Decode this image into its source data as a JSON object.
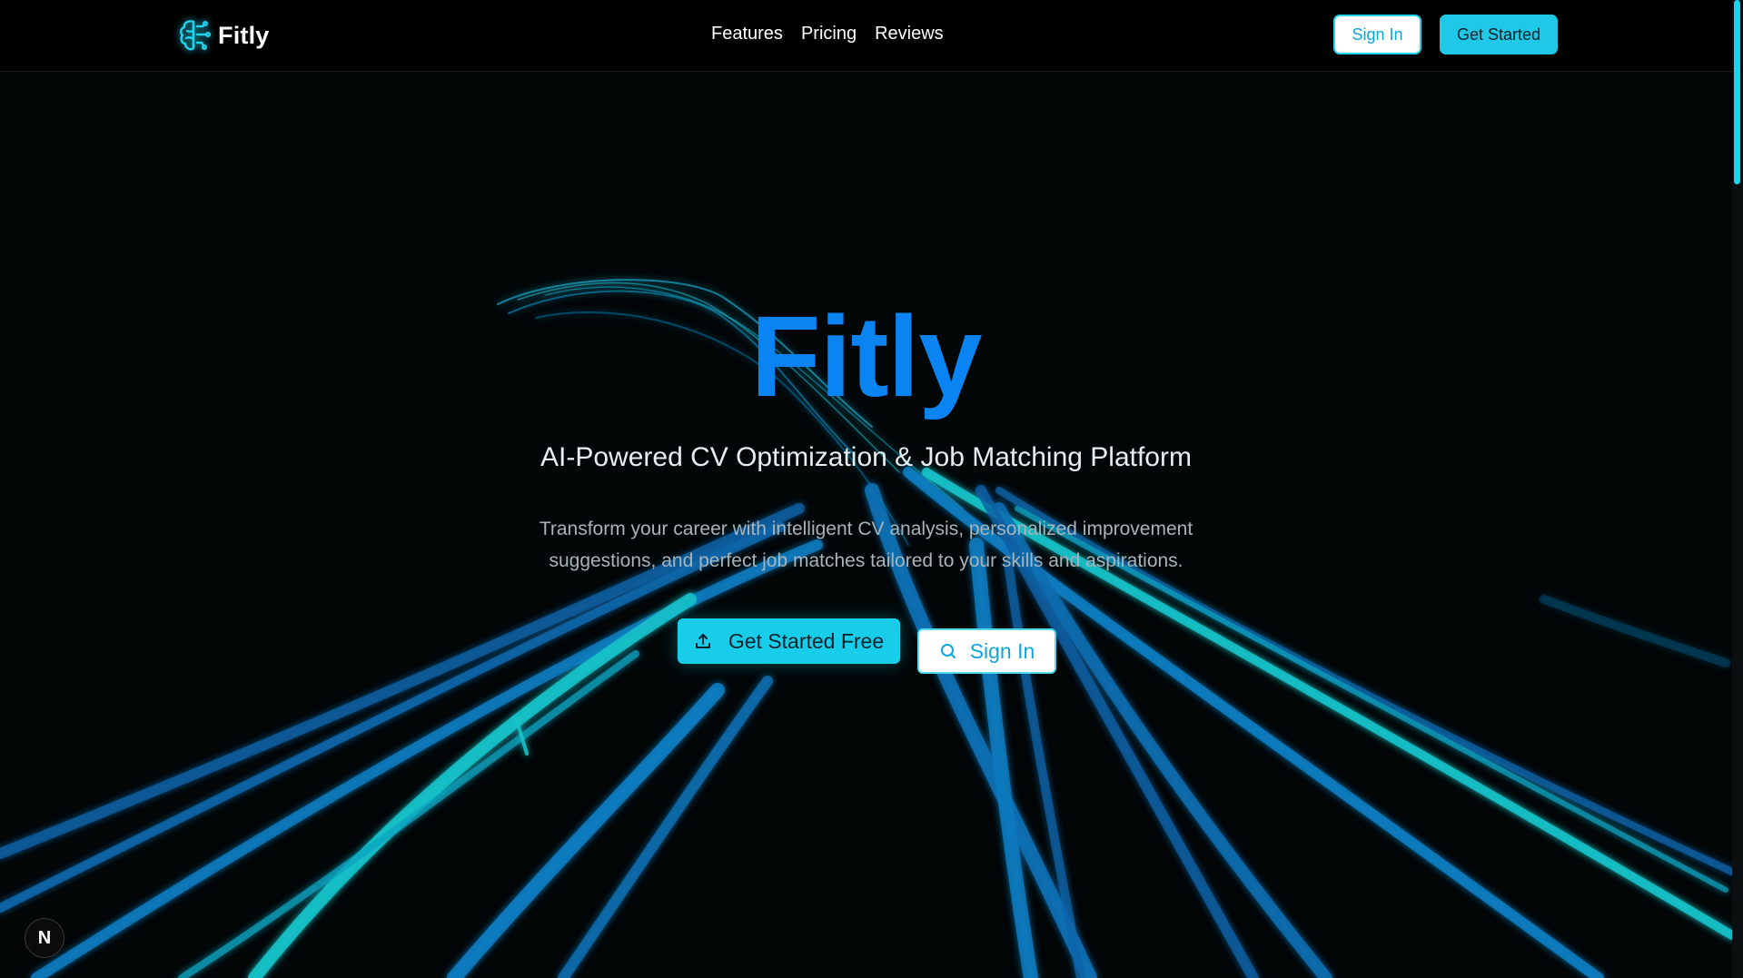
{
  "header": {
    "brand": "Fitly",
    "nav": [
      "Features",
      "Pricing",
      "Reviews"
    ],
    "sign_in": "Sign In",
    "get_started": "Get Started"
  },
  "hero": {
    "title": "Fitly",
    "subtitle": "AI-Powered CV Optimization & Job Matching Platform",
    "description": "Transform your career with intelligent CV analysis, personalized improvement suggestions, and perfect job matches tailored to your skills and aspirations.",
    "primary_cta": "Get Started Free",
    "secondary_cta": "Sign In"
  },
  "dev_badge": "N",
  "colors": {
    "accent": "#17cde9",
    "title_blue": "#0b84f3",
    "background": "#020607"
  },
  "icons": {
    "brand": "brain-circuit-icon",
    "primary_cta": "upload-icon",
    "secondary_cta": "search-icon"
  }
}
